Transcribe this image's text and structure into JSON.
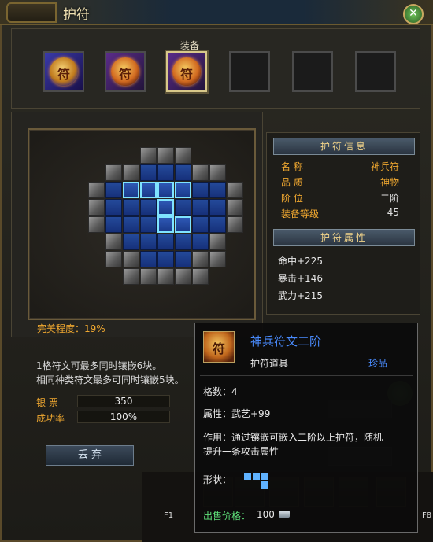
{
  "window": {
    "title": "护符"
  },
  "slots": {
    "equip_label": "装备",
    "items": [
      {
        "glyph": "符",
        "style": "blue"
      },
      {
        "glyph": "符",
        "style": "purple"
      },
      {
        "glyph": "符",
        "style": "purple",
        "equipped": true
      },
      {
        "glyph": ""
      },
      {
        "glyph": ""
      },
      {
        "glyph": ""
      }
    ]
  },
  "grid": {
    "perfect_label": "完美程度：19%"
  },
  "info": {
    "line1": "1格符文可最多同时镶嵌6块。",
    "line2": "相同种类符文最多可同时镶嵌5块。",
    "silver_label": "银 票",
    "silver_value": "350",
    "success_label": "成功率",
    "success_value": "100%",
    "discard_label": "丢 弃"
  },
  "side": {
    "info_header": "护符信息",
    "name_key": "名 称",
    "name_val": "神兵符",
    "quality_key": "品 质",
    "quality_val": "神物",
    "rank_key": "阶 位",
    "rank_val": "二阶",
    "level_key": "装备等级",
    "level_val": "45",
    "attr_header": "护符属性",
    "attrs": [
      "命中+225",
      "暴击+146",
      "武力+215"
    ]
  },
  "tooltip": {
    "name": "神兵符文二阶",
    "type": "护符道具",
    "quality": "珍品",
    "count": "格数：4",
    "attribute": "属性：武艺+99",
    "effect_line1": "作用：通过镶嵌可嵌入二阶以上护符，随机",
    "effect_line2": "提升一条攻击属性",
    "shape_label": "形状：",
    "price_label": "出售价格：",
    "price_value": "100"
  },
  "hotbar": {
    "keys": [
      "F1",
      "F8"
    ]
  },
  "colors": {
    "accent_gold": "#f0a830",
    "tooltip_blue": "#4a8cff",
    "price_green": "#5fe07a"
  }
}
